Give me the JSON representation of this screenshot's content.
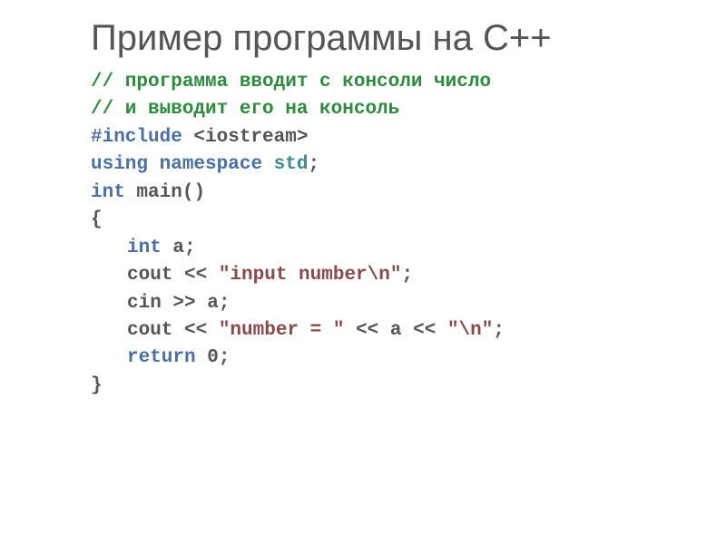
{
  "title": "Пример программы на С++",
  "code": {
    "comment1": "// программа вводит с консоли число",
    "comment2": "// и выводит его на консоль",
    "include_kw": "#include ",
    "include_hdr": "<iostream>",
    "using": "using ",
    "namespace": "namespace ",
    "std": "std",
    "semi": ";",
    "int": "int ",
    "main": "main",
    "parens": "()",
    "lbrace": "{",
    "a": "a",
    "cout": "cout ",
    "lshift": "<< ",
    "str_input": "\"input number\\n\"",
    "cin": "cin ",
    "rshift": ">> ",
    "str_number": "\"number = \" ",
    "lshift2": "<< ",
    "a2": "a ",
    "lshift3": "<< ",
    "str_nl": "\"\\n\"",
    "return": "return ",
    "zero": "0",
    "rbrace": "}"
  }
}
